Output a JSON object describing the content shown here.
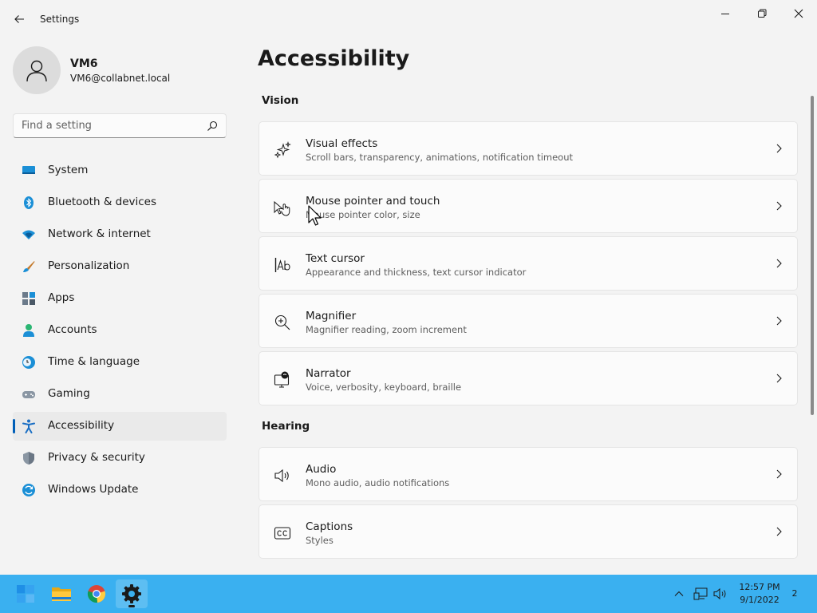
{
  "app": {
    "title": "Settings"
  },
  "user": {
    "name": "VM6",
    "email": "VM6@collabnet.local"
  },
  "search": {
    "placeholder": "Find a setting"
  },
  "nav": [
    {
      "label": "System",
      "icon": "monitor-icon"
    },
    {
      "label": "Bluetooth & devices",
      "icon": "bluetooth-icon"
    },
    {
      "label": "Network & internet",
      "icon": "wifi-icon"
    },
    {
      "label": "Personalization",
      "icon": "brush-icon"
    },
    {
      "label": "Apps",
      "icon": "apps-icon"
    },
    {
      "label": "Accounts",
      "icon": "person-icon"
    },
    {
      "label": "Time & language",
      "icon": "clock-globe-icon"
    },
    {
      "label": "Gaming",
      "icon": "gamepad-icon"
    },
    {
      "label": "Accessibility",
      "icon": "accessibility-icon",
      "active": true
    },
    {
      "label": "Privacy & security",
      "icon": "shield-icon"
    },
    {
      "label": "Windows Update",
      "icon": "update-icon"
    }
  ],
  "main": {
    "title": "Accessibility",
    "sections": [
      {
        "label": "Vision",
        "items": [
          {
            "title": "Visual effects",
            "subtitle": "Scroll bars, transparency, animations, notification timeout",
            "icon": "sparkle-icon"
          },
          {
            "title": "Mouse pointer and touch",
            "subtitle": "Mouse pointer color, size",
            "icon": "mouse-touch-icon"
          },
          {
            "title": "Text cursor",
            "subtitle": "Appearance and thickness, text cursor indicator",
            "icon": "text-cursor-icon"
          },
          {
            "title": "Magnifier",
            "subtitle": "Magnifier reading, zoom increment",
            "icon": "magnifier-icon"
          },
          {
            "title": "Narrator",
            "subtitle": "Voice, verbosity, keyboard, braille",
            "icon": "narrator-icon"
          }
        ]
      },
      {
        "label": "Hearing",
        "items": [
          {
            "title": "Audio",
            "subtitle": "Mono audio, audio notifications",
            "icon": "speaker-icon"
          },
          {
            "title": "Captions",
            "subtitle": "Styles",
            "icon": "captions-icon"
          }
        ]
      }
    ]
  },
  "taskbar": {
    "apps": [
      "windows-start-icon",
      "file-explorer-icon",
      "chrome-icon",
      "settings-gear-icon"
    ],
    "clock": {
      "time": "12:57 PM",
      "date": "9/1/2022"
    },
    "notifications": "2"
  },
  "colors": {
    "accent": "#005fb8",
    "taskbar": "#3ab0f0",
    "window": "#f3f3f3",
    "card": "#fbfbfb"
  }
}
